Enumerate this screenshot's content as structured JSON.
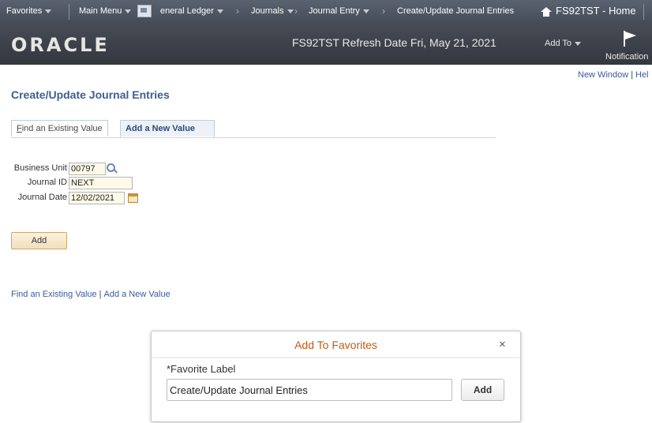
{
  "topnav": {
    "favorites": "Favorites",
    "main_menu": "Main Menu",
    "general_ledger": "eneral Ledger",
    "journals": "Journals",
    "journal_entry": "Journal Entry",
    "current_page": "Create/Update Journal Entries",
    "home": "FS92TST - Home"
  },
  "banner": {
    "logo": "ORACLE",
    "refresh": "FS92TST Refresh Date Fri, May 21, 2021",
    "add_to": "Add To",
    "notification": "Notification"
  },
  "links_top": {
    "new_window": "New Window",
    "help": "Hel"
  },
  "page": {
    "title": "Create/Update Journal Entries"
  },
  "tabs": [
    {
      "first_letter": "F",
      "rest": "ind an Existing Value"
    },
    {
      "label": "Add a New Value"
    }
  ],
  "form": {
    "business_unit_label": "Business Unit",
    "business_unit_value": "00797",
    "journal_id_label": "Journal ID",
    "journal_id_value": "NEXT",
    "journal_date_label": "Journal Date",
    "journal_date_value": "12/02/2021",
    "add_button": "Add"
  },
  "bottom_links": {
    "find": "Find an Existing Value",
    "add": "Add a New Value"
  },
  "modal": {
    "title": "Add To Favorites",
    "close": "×",
    "field_label": "*Favorite Label",
    "field_value": "Create/Update Journal Entries",
    "add_button": "Add"
  }
}
